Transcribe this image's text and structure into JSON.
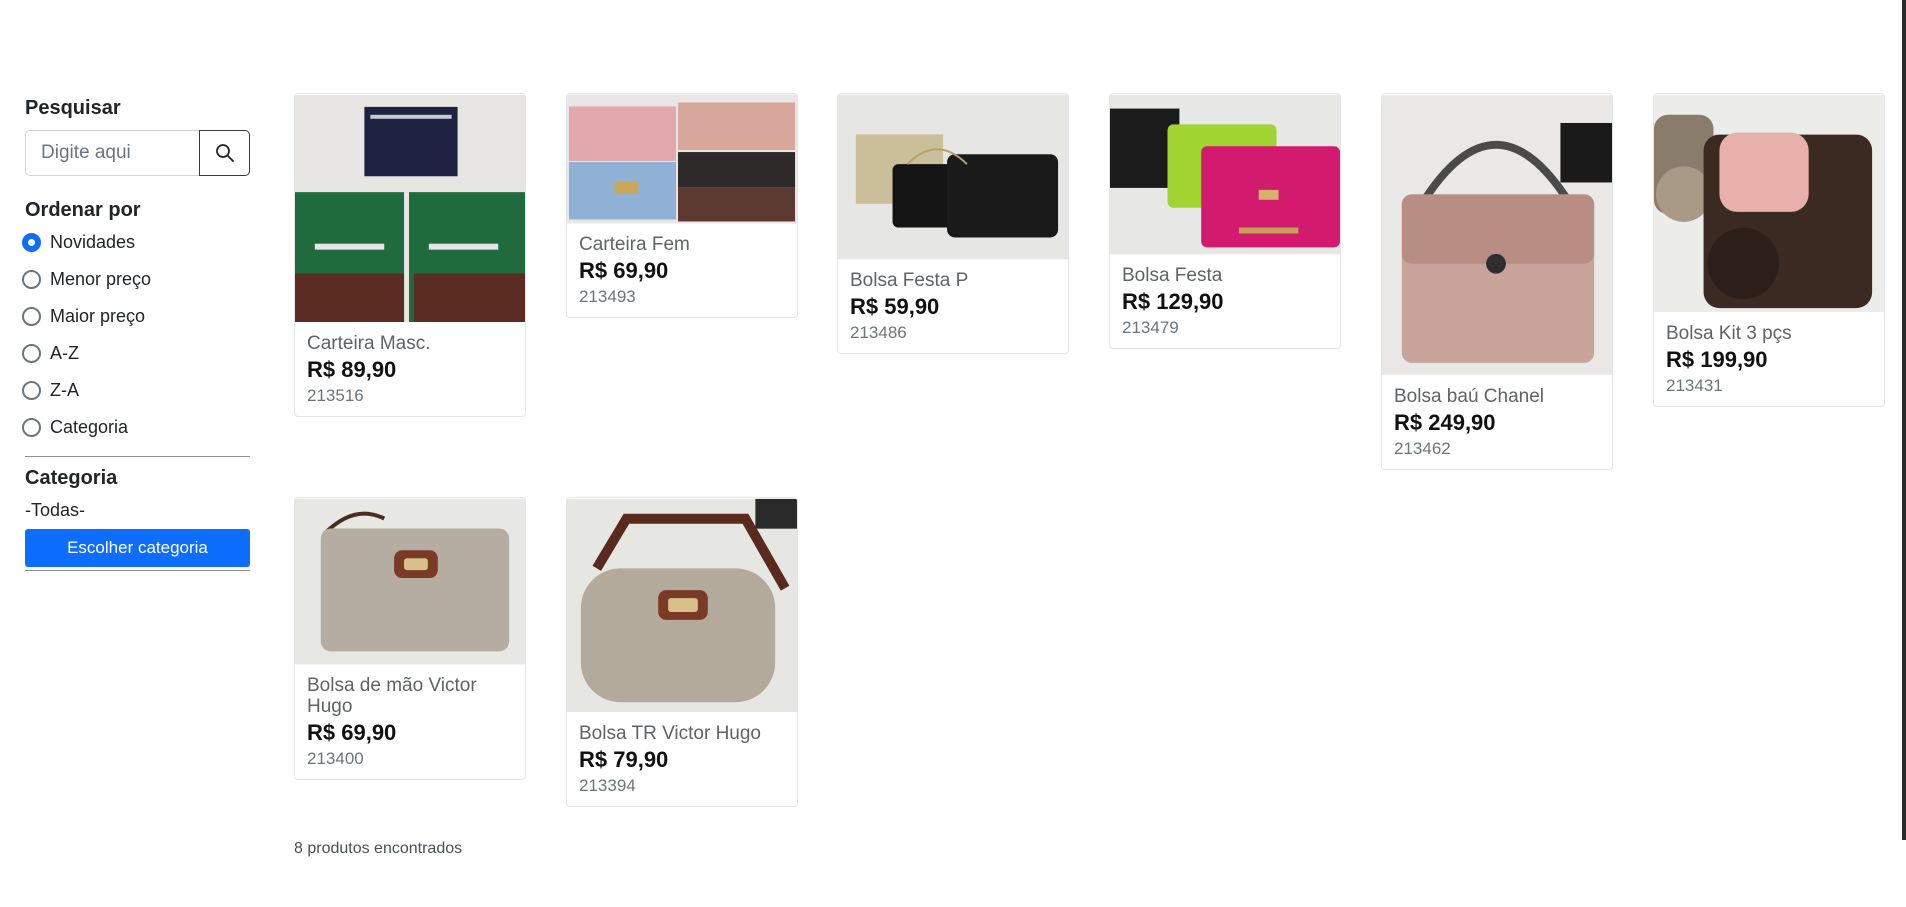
{
  "search": {
    "title": "Pesquisar",
    "placeholder": "Digite aqui",
    "button_icon": "search-icon"
  },
  "sort": {
    "title": "Ordenar por",
    "options": [
      {
        "label": "Novidades",
        "checked": true
      },
      {
        "label": "Menor preço",
        "checked": false
      },
      {
        "label": "Maior preço",
        "checked": false
      },
      {
        "label": "A-Z",
        "checked": false
      },
      {
        "label": "Z-A",
        "checked": false
      },
      {
        "label": "Categoria",
        "checked": false
      }
    ]
  },
  "category": {
    "title": "Categoria",
    "current": "-Todas-",
    "button_label": "Escolher categoria"
  },
  "products": [
    {
      "name": "Carteira Masc.",
      "price": "R$ 89,90",
      "code": "213516",
      "image": "wallet boxes photo"
    },
    {
      "name": "Carteira Fem",
      "price": "R$ 69,90",
      "code": "213493",
      "image": "wallets photo"
    },
    {
      "name": "Bolsa Festa P",
      "price": "R$ 59,90",
      "code": "213486",
      "image": "clutch bags photo"
    },
    {
      "name": "Bolsa Festa",
      "price": "R$ 129,90",
      "code": "213479",
      "image": "quilted bags photo"
    },
    {
      "name": "Bolsa baú Chanel",
      "price": "R$ 249,90",
      "code": "213462",
      "image": "pink handbag photo"
    },
    {
      "name": "Bolsa Kit 3 pçs",
      "price": "R$ 199,90",
      "code": "213431",
      "image": "bag kit photo"
    },
    {
      "name": "Bolsa de mão Victor Hugo",
      "price": "R$ 69,90",
      "code": "213400",
      "image": "pouch photo"
    },
    {
      "name": "Bolsa TR Victor Hugo",
      "price": "R$ 79,90",
      "code": "213394",
      "image": "crossbody bag photo"
    }
  ],
  "results_count": "8 produtos encontrados",
  "colors": {
    "accent": "#0d6efd"
  }
}
